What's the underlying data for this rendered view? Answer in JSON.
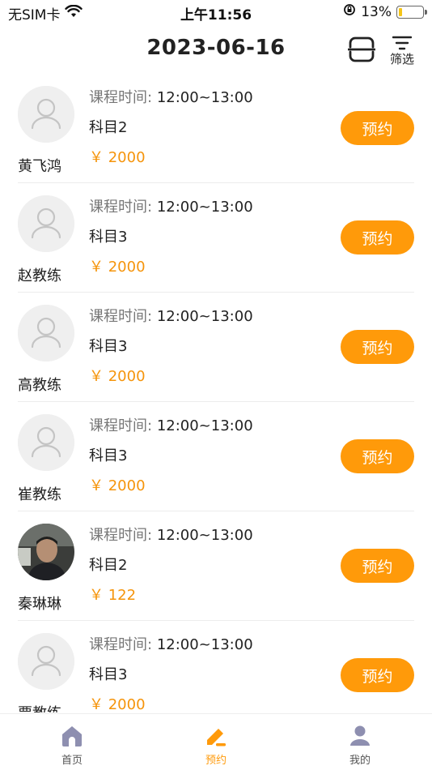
{
  "status_bar": {
    "carrier": "无SIM卡",
    "time": "上午11:56",
    "battery": "13%",
    "battery_level": 0.13
  },
  "header": {
    "title": "2023-06-16",
    "filter_label": "筛选"
  },
  "time_label": "课程时间:",
  "book_label": "预约",
  "items": [
    {
      "name": "黄飞鸿",
      "time": "12:00~13:00",
      "subject": "科目2",
      "price": "￥ 2000",
      "avatar": "placeholder"
    },
    {
      "name": "赵教练",
      "time": "12:00~13:00",
      "subject": "科目3",
      "price": "￥ 2000",
      "avatar": "placeholder"
    },
    {
      "name": "高教练",
      "time": "12:00~13:00",
      "subject": "科目3",
      "price": "￥ 2000",
      "avatar": "placeholder"
    },
    {
      "name": "崔教练",
      "time": "12:00~13:00",
      "subject": "科目3",
      "price": "￥ 2000",
      "avatar": "placeholder"
    },
    {
      "name": "秦琳琳",
      "time": "12:00~13:00",
      "subject": "科目2",
      "price": "￥ 122",
      "avatar": "photo"
    },
    {
      "name": "贾教练",
      "time": "12:00~13:00",
      "subject": "科目3",
      "price": "￥ 2000",
      "avatar": "placeholder"
    }
  ],
  "tabs": [
    {
      "label": "首页",
      "icon": "home-icon"
    },
    {
      "label": "预约",
      "icon": "edit-icon"
    },
    {
      "label": "我的",
      "icon": "user-icon"
    }
  ],
  "colors": {
    "accent": "#ff9a0a",
    "price": "#f5940b",
    "tab_inactive_icon": "#8e8fb0"
  }
}
